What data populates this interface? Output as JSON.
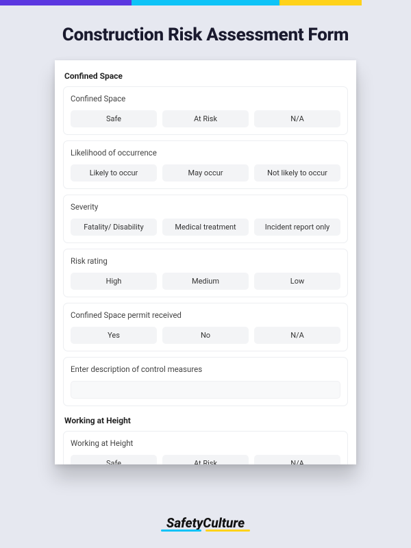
{
  "title": "Construction Risk Assessment Form",
  "sections": [
    {
      "heading": "Confined Space",
      "questions": [
        {
          "label": "Confined Space",
          "options": [
            "Safe",
            "At Risk",
            "N/A"
          ]
        },
        {
          "label": "Likelihood of occurrence",
          "options": [
            "Likely to occur",
            "May occur",
            "Not likely to occur"
          ]
        },
        {
          "label": "Severity",
          "options": [
            "Fatality/ Disability",
            "Medical treatment",
            "Incident report only"
          ]
        },
        {
          "label": "Risk rating",
          "options": [
            "High",
            "Medium",
            "Low"
          ]
        },
        {
          "label": "Confined Space permit received",
          "options": [
            "Yes",
            "No",
            "N/A"
          ]
        },
        {
          "label": "Enter description of control measures",
          "textarea": true
        }
      ]
    },
    {
      "heading": "Working at Height",
      "questions": [
        {
          "label": "Working at Height",
          "options": [
            "Safe",
            "At Risk",
            "N/A"
          ]
        }
      ]
    }
  ],
  "brand": {
    "name": "SafetyCulture"
  }
}
